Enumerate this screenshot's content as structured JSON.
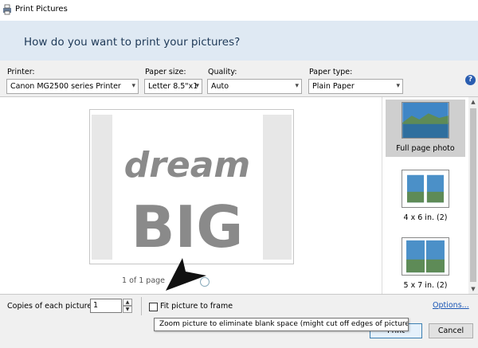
{
  "window": {
    "title": "Print Pictures"
  },
  "header": {
    "prompt": "How do you want to print your pictures?"
  },
  "controls": {
    "printer": {
      "label": "Printer:",
      "value": "Canon MG2500 series Printer"
    },
    "paper_size": {
      "label": "Paper size:",
      "value": "Letter 8.5\"x1"
    },
    "quality": {
      "label": "Quality:",
      "value": "Auto"
    },
    "paper_type": {
      "label": "Paper type:",
      "value": "Plain Paper"
    },
    "help": "?"
  },
  "preview": {
    "image_text_top": "dream",
    "image_text_bottom": "BIG",
    "page_info": "1 of 1 page"
  },
  "layouts": [
    {
      "label": "Full page photo",
      "selected": true
    },
    {
      "label": "4 x 6 in. (2)",
      "selected": false
    },
    {
      "label": "5 x 7 in. (2)",
      "selected": false
    }
  ],
  "bottom": {
    "copies_label": "Copies of each picture:",
    "copies_value": "1",
    "fit_label": "Fit picture to frame",
    "fit_checked": false,
    "options_link": "Options...",
    "print_label": "Print",
    "cancel_label": "Cancel"
  },
  "tooltip": {
    "text": "Zoom picture to eliminate blank space (might cut off edges of picture)"
  },
  "colors": {
    "header_band": "#dfe9f3",
    "header_text": "#1e3957",
    "link": "#1a56b5",
    "image_text": "#8a8a8a"
  }
}
